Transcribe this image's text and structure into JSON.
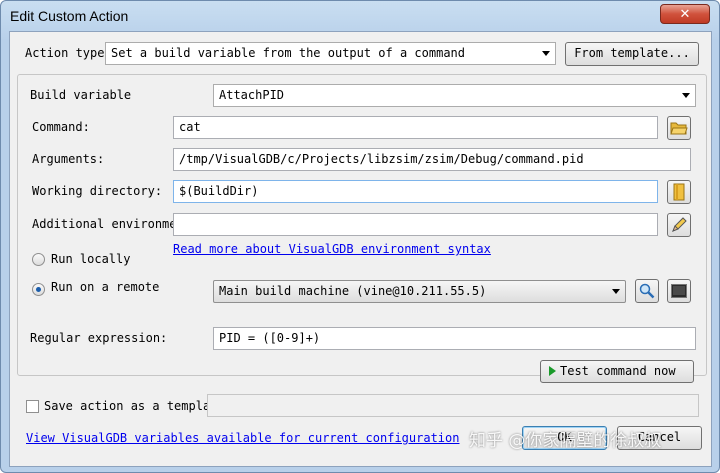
{
  "window": {
    "title": "Edit Custom Action",
    "close_label": "✕"
  },
  "action_type": {
    "label": "Action type",
    "value": "Set a build variable from the output of a command",
    "template_button": "From template..."
  },
  "build_variable": {
    "label": "Build variable",
    "value": "AttachPID"
  },
  "command": {
    "label": "Command:",
    "value": "cat"
  },
  "arguments": {
    "label": "Arguments:",
    "value": "/tmp/VisualGDB/c/Projects/libzsim/zsim/Debug/command.pid"
  },
  "working_directory": {
    "label": "Working directory:",
    "value": "$(BuildDir)"
  },
  "additional_env": {
    "label": "Additional environme",
    "value": ""
  },
  "env_syntax_link": "Read more about VisualGDB environment syntax",
  "run_locally": {
    "label": "Run locally",
    "checked": false
  },
  "run_remote": {
    "label": "Run on a remote",
    "checked": true,
    "machine": "Main build machine (vine@10.211.55.5)"
  },
  "regex": {
    "label": "Regular expression:",
    "value": "PID = ([0-9]+)"
  },
  "test_button": "Test command now",
  "save_template": {
    "label": "Save action as a templa",
    "value": ""
  },
  "variables_link": "View VisualGDB variables available for current configuration",
  "ok_button": "OK",
  "cancel_button": "Cancel",
  "watermark": "知乎 @你家隔壁的徐叔叔",
  "colors": {
    "title_bar": "#b8d0ea",
    "link": "#0000ee",
    "close_button": "#c03a25"
  }
}
